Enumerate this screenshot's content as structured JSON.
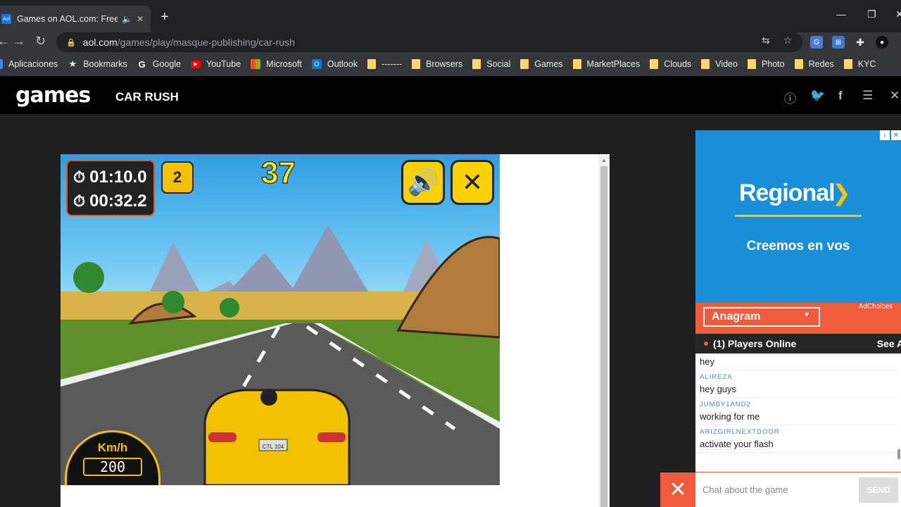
{
  "browser": {
    "tab_title": "Games on AOL.com: Free onl",
    "tab_favicon": "Aol",
    "url_host": "aol.com",
    "url_path": "/games/play/masque-publishing/car-rush",
    "bookmarks": [
      {
        "label": "Aplicaciones",
        "icon": "apps-icon",
        "color": "#4285f4"
      },
      {
        "label": "Bookmarks",
        "icon": "star-icon",
        "color": "#e8eaed"
      },
      {
        "label": "Google",
        "icon": "google-icon",
        "color": "#ffffff"
      },
      {
        "label": "YouTube",
        "icon": "youtube-icon",
        "color": "#ff0000"
      },
      {
        "label": "Microsoft",
        "icon": "microsoft-icon",
        "color": "#f25022"
      },
      {
        "label": "Outlook",
        "icon": "outlook-icon",
        "color": "#0078d4"
      },
      {
        "label": "-------",
        "icon": "folder-icon",
        "color": "#fdd663"
      },
      {
        "label": "Browsers",
        "icon": "folder-icon",
        "color": "#fdd663"
      },
      {
        "label": "Social",
        "icon": "folder-icon",
        "color": "#fdd663"
      },
      {
        "label": "Games",
        "icon": "folder-icon",
        "color": "#fdd663"
      },
      {
        "label": "MarketPlaces",
        "icon": "folder-icon",
        "color": "#fdd663"
      },
      {
        "label": "Clouds",
        "icon": "folder-icon",
        "color": "#fdd663"
      },
      {
        "label": "Video",
        "icon": "folder-icon",
        "color": "#fdd663"
      },
      {
        "label": "Photo",
        "icon": "folder-icon",
        "color": "#fdd663"
      },
      {
        "label": "Redes",
        "icon": "folder-icon",
        "color": "#fdd663"
      },
      {
        "label": "KYC",
        "icon": "folder-icon",
        "color": "#fdd663"
      }
    ]
  },
  "site": {
    "logo": "games",
    "game_title": "CAR RUSH"
  },
  "game": {
    "timer_total": "01:10.0",
    "timer_lap": "00:32.2",
    "level": "2",
    "score": "37",
    "speed_unit": "Km/h",
    "speed_value": "200",
    "license_plate": "CTL 104"
  },
  "ad": {
    "brand": "Regional",
    "tagline": "Creemos en vos",
    "adchoices": "AdChoices"
  },
  "chat": {
    "room": "Anagram",
    "players_online": "(1) Players Online",
    "see_all": "See Al",
    "messages": [
      {
        "user": "",
        "text": "hey"
      },
      {
        "user": "ALIREZA",
        "text": "hey guys"
      },
      {
        "user": "JUMBY1AND2",
        "text": "working for me"
      },
      {
        "user": "ARIZGIRLNEXTDOOR",
        "text": "activate your flash"
      }
    ],
    "input_placeholder": "Chat about the game",
    "send_label": "SEND"
  },
  "colors": {
    "accent": "#f05a3d",
    "ad_blue": "#1a8fd9",
    "ad_yellow": "#fdc500",
    "game_yellow": "#f7d100"
  }
}
